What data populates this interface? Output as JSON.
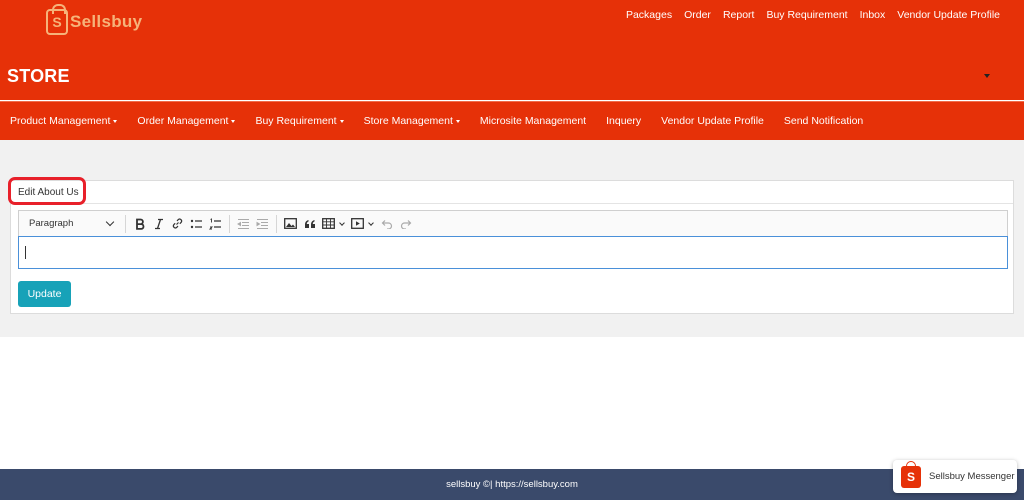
{
  "brand": {
    "logo_letter": "S",
    "logo_text": "Sellsbuy",
    "accent_color": "#e63108"
  },
  "top_links": [
    "Packages",
    "Order",
    "Report",
    "Buy Requirement",
    "Inbox",
    "Vendor Update Profile"
  ],
  "store": {
    "title": "STORE"
  },
  "nav": {
    "items": [
      {
        "label": "Product Management",
        "dropdown": true
      },
      {
        "label": "Order Management",
        "dropdown": true
      },
      {
        "label": "Buy Requirement",
        "dropdown": true
      },
      {
        "label": "Store Management",
        "dropdown": true
      },
      {
        "label": "Microsite Management",
        "dropdown": false
      },
      {
        "label": "Inquery",
        "dropdown": false
      },
      {
        "label": "Vendor Update Profile",
        "dropdown": false
      },
      {
        "label": "Send Notification",
        "dropdown": false
      }
    ]
  },
  "panel": {
    "title": "Edit About Us"
  },
  "editor": {
    "heading_select": "Paragraph",
    "value": "",
    "toolbar_icons": [
      "bold-icon",
      "italic-icon",
      "link-icon",
      "bulleted-list-icon",
      "numbered-list-icon",
      "outdent-icon",
      "indent-icon",
      "image-icon",
      "blockquote-icon",
      "table-icon",
      "media-icon",
      "undo-icon",
      "redo-icon"
    ]
  },
  "actions": {
    "update_label": "Update",
    "update_color": "#17a2b8"
  },
  "footer": {
    "text": "sellsbuy ©| https://sellsbuy.com"
  },
  "messenger": {
    "icon_letter": "S",
    "label": "Sellsbuy Messenger"
  }
}
